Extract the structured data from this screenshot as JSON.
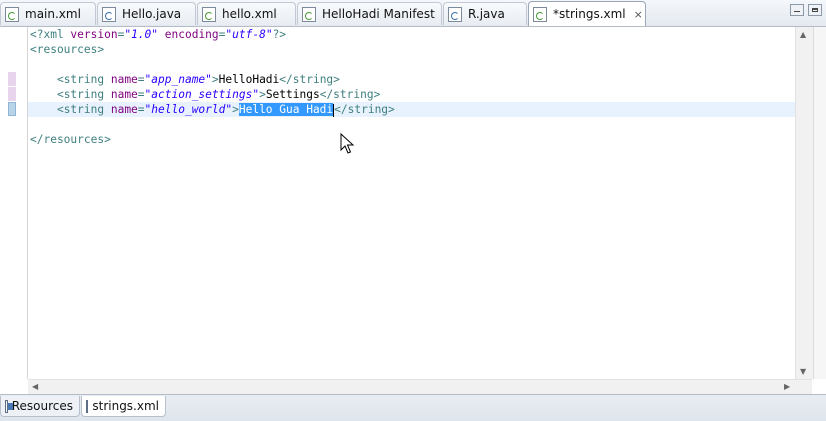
{
  "tabs": [
    {
      "label": "main.xml",
      "icon": "xml-file-icon"
    },
    {
      "label": "Hello.java",
      "icon": "java-file-icon"
    },
    {
      "label": "hello.xml",
      "icon": "xml-file-icon"
    },
    {
      "label": "HelloHadi Manifest",
      "icon": "xml-file-icon"
    },
    {
      "label": "R.java",
      "icon": "java-file-icon"
    },
    {
      "label": "*strings.xml",
      "icon": "xml-file-icon",
      "close": "×"
    }
  ],
  "code": {
    "xml_decl": {
      "open": "<?xml ",
      "version_attr": "version",
      "version_val": "\"1.0\"",
      "encoding_attr": "encoding",
      "encoding_val": "\"utf-8\"",
      "close": "?>"
    },
    "resources_open": "<resources>",
    "strings": [
      {
        "open": "<string ",
        "attr": "name",
        "eq": "=",
        "value": "\"app_name\"",
        "gt": ">",
        "text": "HelloHadi",
        "close": "</string>"
      },
      {
        "open": "<string ",
        "attr": "name",
        "eq": "=",
        "value": "\"action_settings\"",
        "gt": ">",
        "text": "Settings",
        "close": "</string>"
      },
      {
        "open": "<string ",
        "attr": "name",
        "eq": "=",
        "value": "\"hello_world\"",
        "gt": ">",
        "text": "Hello Gua Hadi",
        "close": "</string>"
      }
    ],
    "resources_close": "</resources>"
  },
  "bottom_tabs": [
    {
      "label": "Resources",
      "icon": "resources-grid-icon"
    },
    {
      "label": "strings.xml",
      "icon": "source-document-icon"
    }
  ],
  "colors": {
    "tag": "#3f7f7f",
    "attribute": "#7f007f",
    "value": "#2a00ff",
    "selection": "#3399ff",
    "current_line": "#e8f2fe"
  }
}
